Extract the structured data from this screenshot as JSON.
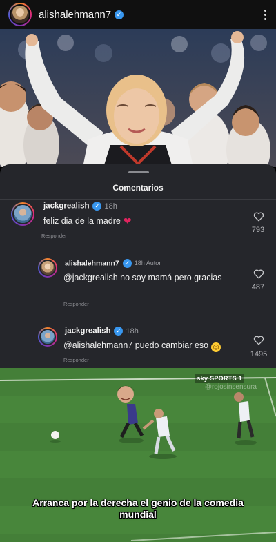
{
  "post": {
    "username": "alishalehmann7",
    "verified_glyph": "✓",
    "more_icon": "more-vertical-icon"
  },
  "comments_panel": {
    "title": "Comentarios",
    "comments": [
      {
        "username": "jackgrealish",
        "time": "18h",
        "text": "feliz dia de la madre",
        "emoji": "❤",
        "reply_label": "Responder",
        "likes": "793"
      },
      {
        "username": "alishalehmann7",
        "time": "18h Autor",
        "text": "@jackgrealish no soy mamá pero gracias",
        "reply_label": "Responder",
        "likes": "487"
      },
      {
        "username": "jackgrealish",
        "time": "18h",
        "text": "@alishalehmann7 puedo cambiar eso",
        "emoji": "😉",
        "reply_label": "Responder",
        "likes": "1495"
      }
    ]
  },
  "meme": {
    "broadcast_logo": "sky SPORTS 1",
    "watermark": "@rojosinsensura",
    "caption": "Arranca por la derecha el genio de la comedia mundial"
  },
  "colors": {
    "accent_verified": "#3897f0",
    "sheet_background": "#25262b",
    "heart_red": "#e0245e",
    "pitch_green": "#4a8a3c"
  }
}
